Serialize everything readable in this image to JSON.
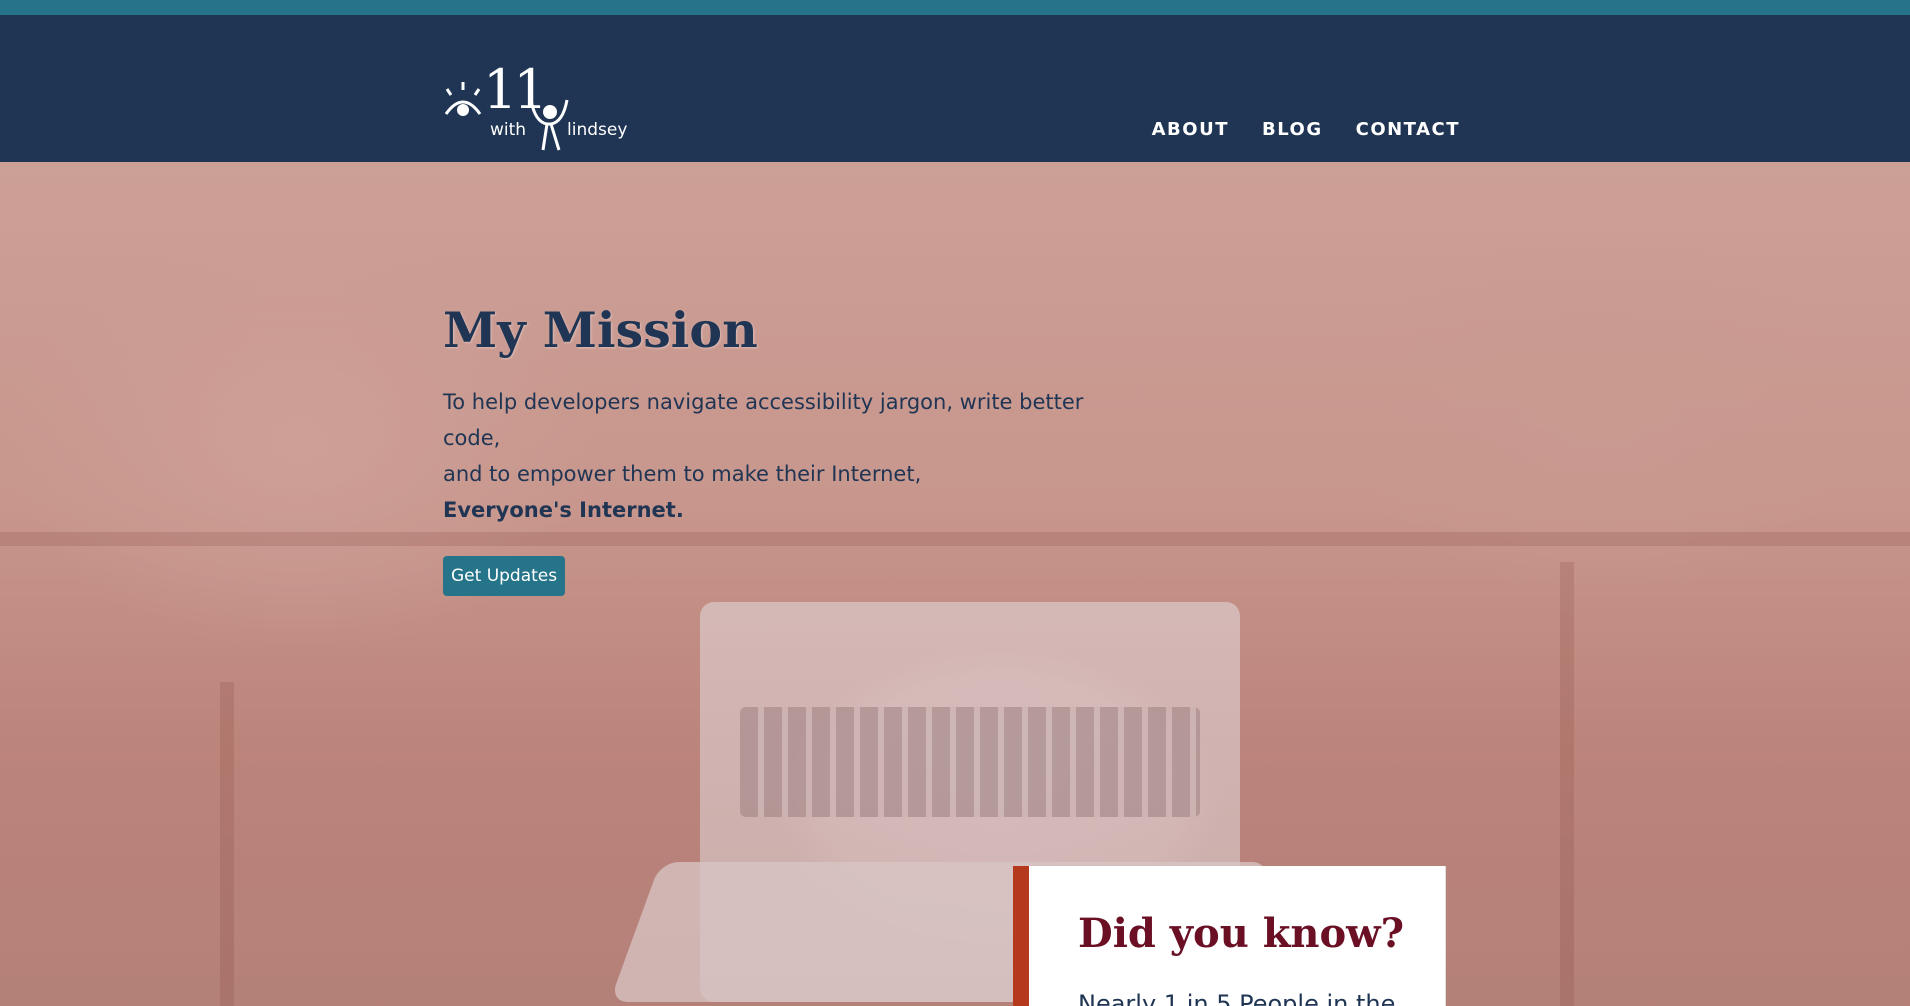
{
  "header": {
    "logo": {
      "mark": "11",
      "with": "with",
      "name": "lindsey"
    },
    "nav": [
      {
        "label": "ABOUT"
      },
      {
        "label": "BLOG"
      },
      {
        "label": "CONTACT"
      }
    ]
  },
  "hero": {
    "title": "My Mission",
    "text_line1": "To help developers navigate accessibility jargon, write better code,",
    "text_line2": "and to empower them to make their Internet,",
    "text_strong": "Everyone's Internet.",
    "button_label": "Get Updates"
  },
  "callout": {
    "title": "Did you know?",
    "text": "Nearly 1 in 5 People in the"
  },
  "colors": {
    "header_bg": "#1f3553",
    "accent_bar": "#267489",
    "button": "#267489",
    "callout_border": "#b5391c",
    "callout_title": "#6a0f24"
  },
  "icons": [
    "logo-eye-icon",
    "logo-person-icon"
  ]
}
